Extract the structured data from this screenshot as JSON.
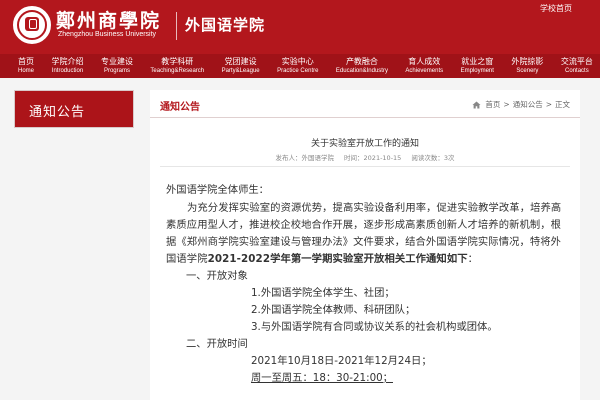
{
  "header": {
    "university_name": "鄭州商學院",
    "university_name_en": "Zhengzhou Business University",
    "college_name": "外国语学院",
    "school_home_link": "学校首页",
    "brand_color": "#b3171d"
  },
  "nav": {
    "items": [
      {
        "zh": "首页",
        "en": "Home"
      },
      {
        "zh": "学院介绍",
        "en": "Introduction"
      },
      {
        "zh": "专业建设",
        "en": "Programs"
      },
      {
        "zh": "教学科研",
        "en": "Teaching&Research"
      },
      {
        "zh": "党团建设",
        "en": "Party&League"
      },
      {
        "zh": "实验中心",
        "en": "Practice Centre"
      },
      {
        "zh": "产教融合",
        "en": "Education&Industry"
      },
      {
        "zh": "育人成效",
        "en": "Achievements"
      },
      {
        "zh": "就业之窗",
        "en": "Employment"
      },
      {
        "zh": "外院掠影",
        "en": "Scenery"
      },
      {
        "zh": "交流平台",
        "en": "Contacts"
      }
    ]
  },
  "sidebar": {
    "title": "通知公告"
  },
  "main": {
    "section_label": "通知公告",
    "breadcrumb": [
      "首页",
      "通知公告",
      "正文"
    ],
    "breadcrumb_sep": ">",
    "article": {
      "title": "关于实验室开放工作的通知",
      "meta_publisher": "发布人：外国语学院",
      "meta_time": "时间：2021-10-15",
      "meta_views": "阅读次数：3次",
      "greeting": "外国语学院全体师生：",
      "intro_part1": "为充分发挥实验室的资源优势，提高实验设备利用率，促进实验教学改革，培养高素质应用型人才，推进校企校地合作开展，逐步形成高素质创新人才培养的新机制，根据《郑州商学院实验室建设与管理办法》文件要求，结合外国语学院实际情况，特将外国语学院",
      "intro_bold": "2021-2022学年第一学期实验室开放相关工作通知如下",
      "intro_part2": "：",
      "heading_1": "一、开放对象",
      "items_1": [
        "1.外国语学院全体学生、社团；",
        "2.外国语学院全体教师、科研团队；",
        "3.与外国语学院有合同或协议关系的社会机构或团体。"
      ],
      "heading_2": "二、开放时间",
      "time_range": "2021年10月18日-2021年12月24日；",
      "time_weekday": "周一至周五：18：30-21:00；"
    }
  }
}
